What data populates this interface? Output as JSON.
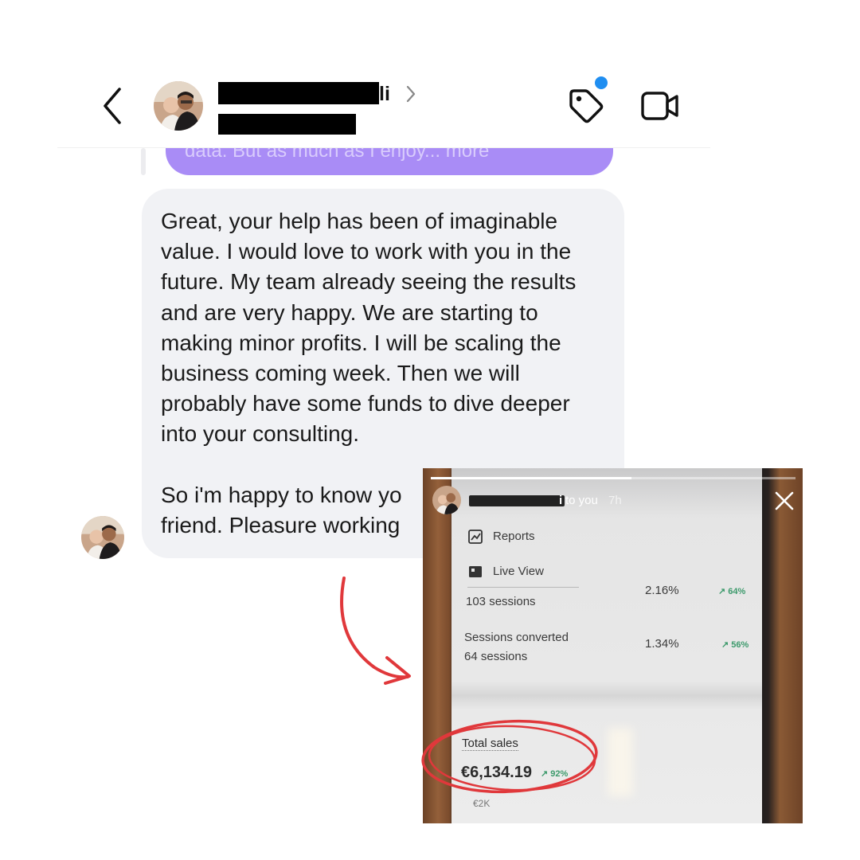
{
  "header": {
    "name_visible_suffix": "li",
    "notification_color": "#1f8ef1"
  },
  "previous_message": {
    "text": "data. But as much as I enjoy... more",
    "bubble_color": "#a98cf6"
  },
  "message": {
    "paragraph_1": "Great, your help has been of imaginable value. I would love to work with you in the future. My team already seeing the results and are very happy. We are starting to making minor profits. I will be scaling the business coming week. Then we will probably have some funds to dive deeper into your consulting.",
    "paragraph_2": "So i'm happy to know yo",
    "paragraph_2b": "friend. Pleasure working",
    "bubble_color": "#f1f2f5"
  },
  "story": {
    "sender_suffix": "i",
    "to_you": "to you",
    "time": "7h",
    "progress": 0.55,
    "menu": [
      {
        "icon": "reports-icon",
        "label": "Reports"
      },
      {
        "icon": "live-view-icon",
        "label": "Live View"
      }
    ],
    "rows": [
      {
        "label": "",
        "sub": "103 sessions",
        "value": "2.16%",
        "change": "↗ 64%"
      },
      {
        "label": "Sessions converted",
        "sub": "64 sessions",
        "value": "1.34%",
        "change": "↗ 56%"
      }
    ],
    "total_sales_label": "Total sales",
    "total_sales_value": "€6,134.19",
    "total_sales_change": "↗ 92%",
    "axis_tick": "€2K"
  },
  "annotation": {
    "circle_color": "#e0383b",
    "arrow_color": "#e0383b"
  }
}
